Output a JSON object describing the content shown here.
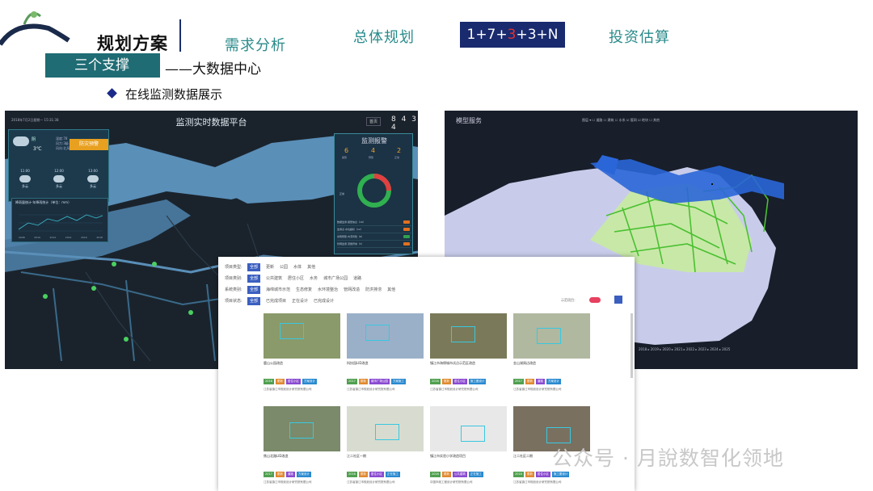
{
  "header": {
    "title": "规划方案",
    "nav": [
      "需求分析",
      "总体规划",
      "投资估算"
    ],
    "active_nav": {
      "p1": "1+7+",
      "p2": "3",
      "p3": "+3+N"
    }
  },
  "subheader": {
    "tag": "三个支撑",
    "subtitle": "——大数据中心",
    "section": "在线监测数据展示"
  },
  "dashboard": {
    "title": "监测实时数据平台",
    "date": "2018年7月2日星期一  15:31:38",
    "nums": "8 4 3 4",
    "btn": "首页",
    "weather": {
      "now": "阴",
      "temp": "3℃",
      "info": [
        "湿度:78",
        "风力:3级",
        "风向:北风"
      ],
      "warn": "防灾预警",
      "forecast": [
        {
          "t": "11:00",
          "w": "多云"
        },
        {
          "t": "12:00",
          "w": "多云"
        },
        {
          "t": "13:00",
          "w": "多云"
        }
      ]
    },
    "chart_title": "降雨量统计·年降雨统计（单位：mm）",
    "x_ticks": [
      "2008",
      "2010",
      "2012",
      "2014",
      "2016",
      "2018"
    ],
    "monitor": {
      "title": "监测报警",
      "counts": [
        "6",
        "4",
        "2"
      ],
      "labels": [
        "报警",
        "预警",
        "正常"
      ],
      "donut_label": "正常",
      "items": [
        "数据监测·报警信息（18）",
        "监测点·水位超标（12）",
        "暴雨预警·内涝风险（8）",
        "管网监测·流量异常（5）"
      ]
    }
  },
  "map": {
    "title": "模型服务",
    "controls": "图层 ▾  ☐ 道路  ☐ 建筑  ☐ 水系  ☑ 管网  ☑ 地块  ☐ 其他",
    "timeline": "2018 ▸ 2019 ▸ 2020 ▸ 2021 ▸ 2022 ▸ 2023 ▸ 2024 ▸ 2025"
  },
  "panel": {
    "filters": [
      {
        "label": "项目类型:",
        "opts": [
          "全部",
          "更新",
          "公园",
          "水体",
          "其他"
        ]
      },
      {
        "label": "项目类别:",
        "opts": [
          "全部",
          "公共建筑",
          "居住小区",
          "水务",
          "城市广场公园",
          "道路"
        ]
      },
      {
        "label": "系统类别:",
        "opts": [
          "全部",
          "海绵城市示范",
          "生态修复",
          "水环境整治",
          "管网改造",
          "防洪排涝",
          "其他"
        ]
      },
      {
        "label": "项目状态:",
        "opts": [
          "全部",
          "已完成项目",
          "正在设计",
          "已完成设计"
        ]
      }
    ],
    "toggle_label": "示范项目：",
    "cards": [
      {
        "name": "鹿山公园改造",
        "tags": [
          "2016",
          "更新",
          "居住小区",
          "方案设计"
        ],
        "desc": "江苏省镇江市规划设计研究院有限公司"
      },
      {
        "name": "科技园LID改造",
        "tags": [
          "2017",
          "更新",
          "城市广场公园",
          "方案施工"
        ],
        "desc": "江苏省镇江市规划设计研究院有限公司"
      },
      {
        "name": "镇江市海绵城市试点示范区改造",
        "tags": [
          "2016",
          "更新",
          "居住小区",
          "施工图设计"
        ],
        "desc": "江苏省镇江市规划设计研究院有限公司"
      },
      {
        "name": "金山湖周边改造",
        "tags": [
          "2017",
          "更新",
          "道路",
          "方案设计"
        ],
        "desc": "江苏省镇江市规划设计研究院有限公司"
      },
      {
        "name": "焦山北路LID改造",
        "tags": [
          "2017",
          "更新",
          "道路",
          "方案设计"
        ],
        "desc": "江苏省镇江市规划设计研究院有限公司"
      },
      {
        "name": "江二社区一期",
        "tags": [
          "2016",
          "更新",
          "居住小区",
          "正在施工"
        ],
        "desc": "江苏省镇江市规划设计研究院有限公司"
      },
      {
        "name": "镇江市实验小学改造项目",
        "tags": [
          "2016",
          "更新",
          "公共建筑",
          "正在施工"
        ],
        "desc": "中国市政工程设计研究院有限公司"
      },
      {
        "name": "江二社区二期",
        "tags": [
          "2016",
          "更新",
          "居住小区",
          "施工图设计"
        ],
        "desc": "江苏省镇江市规划设计研究院有限公司"
      }
    ]
  },
  "watermark": "公众号 · 月說数智化领地"
}
